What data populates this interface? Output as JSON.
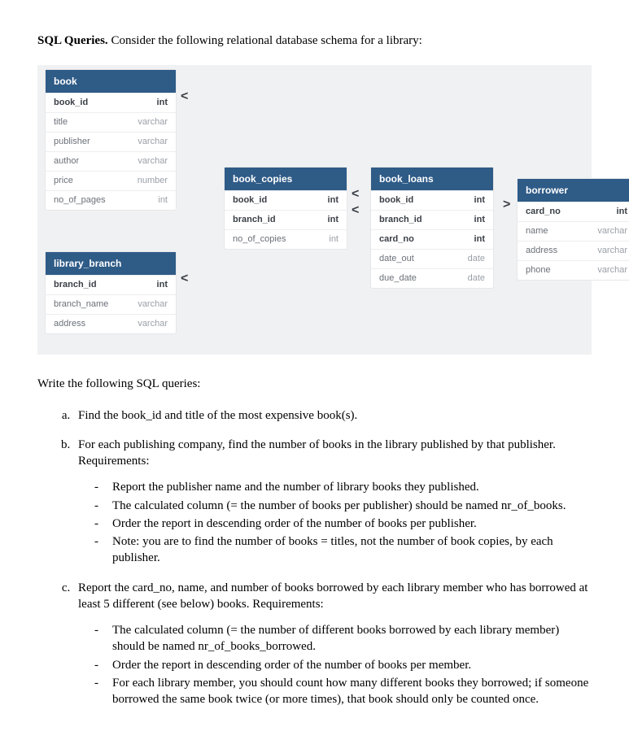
{
  "heading": {
    "bold": "SQL Queries.",
    "rest": " Consider the following relational database schema for a library:"
  },
  "tables": {
    "book": {
      "title": "book",
      "rows": [
        {
          "n": "book_id",
          "t": "int",
          "bold": true
        },
        {
          "n": "title",
          "t": "varchar"
        },
        {
          "n": "publisher",
          "t": "varchar"
        },
        {
          "n": "author",
          "t": "varchar"
        },
        {
          "n": "price",
          "t": "number"
        },
        {
          "n": "no_of_pages",
          "t": "int"
        }
      ]
    },
    "library_branch": {
      "title": "library_branch",
      "rows": [
        {
          "n": "branch_id",
          "t": "int",
          "bold": true
        },
        {
          "n": "branch_name",
          "t": "varchar"
        },
        {
          "n": "address",
          "t": "varchar"
        }
      ]
    },
    "book_copies": {
      "title": "book_copies",
      "rows": [
        {
          "n": "book_id",
          "t": "int",
          "bold": true
        },
        {
          "n": "branch_id",
          "t": "int",
          "bold": true
        },
        {
          "n": "no_of_copies",
          "t": "int"
        }
      ]
    },
    "book_loans": {
      "title": "book_loans",
      "rows": [
        {
          "n": "book_id",
          "t": "int",
          "bold": true
        },
        {
          "n": "branch_id",
          "t": "int",
          "bold": true
        },
        {
          "n": "card_no",
          "t": "int",
          "bold": true
        },
        {
          "n": "date_out",
          "t": "date"
        },
        {
          "n": "due_date",
          "t": "date"
        }
      ]
    },
    "borrower": {
      "title": "borrower",
      "rows": [
        {
          "n": "card_no",
          "t": "int",
          "bold": true
        },
        {
          "n": "name",
          "t": "varchar"
        },
        {
          "n": "address",
          "t": "varchar"
        },
        {
          "n": "phone",
          "t": "varchar"
        }
      ]
    }
  },
  "arrows": {
    "lt": "<",
    "gt": ">"
  },
  "intro": "Write the following SQL queries:",
  "qa": {
    "text": "Find the book_id and title of the most expensive book(s)."
  },
  "qb": {
    "text": "For each publishing company, find the number of books in the library published by that publisher. Requirements:",
    "items": [
      "Report the publisher name and the number of library books they published.",
      "The calculated column (= the number of books per publisher) should be named nr_of_books.",
      "Order the report in descending order of the number of books per publisher.",
      "Note: you are to find the number of books = titles, not the number of book copies, by each publisher."
    ]
  },
  "qc": {
    "text": "Report the card_no, name, and number of books borrowed by each library member who has borrowed at least 5 different (see below) books. Requirements:",
    "items": [
      "The calculated column (= the number of different books borrowed by each library member) should be named nr_of_books_borrowed.",
      "Order the report in descending order of the number of books per member.",
      "For each library member, you should count how many different books they borrowed; if someone borrowed the same book twice (or more times), that book should only be counted once."
    ]
  }
}
